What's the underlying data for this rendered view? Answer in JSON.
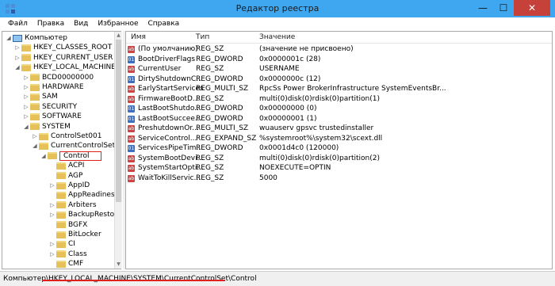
{
  "window": {
    "title": "Редактор реестра",
    "minimize": "—",
    "maximize": "☐",
    "close": "✕"
  },
  "menu": [
    "Файл",
    "Правка",
    "Вид",
    "Избранное",
    "Справка"
  ],
  "tree": [
    {
      "label": "Компьютер",
      "indent": 0,
      "arrow": "◢",
      "icon": "computer"
    },
    {
      "label": "HKEY_CLASSES_ROOT",
      "indent": 1,
      "arrow": "▷",
      "icon": "folder"
    },
    {
      "label": "HKEY_CURRENT_USER",
      "indent": 1,
      "arrow": "▷",
      "icon": "folder"
    },
    {
      "label": "HKEY_LOCAL_MACHINE",
      "indent": 1,
      "arrow": "◢",
      "icon": "folder"
    },
    {
      "label": "BCD00000000",
      "indent": 2,
      "arrow": "▷",
      "icon": "folder"
    },
    {
      "label": "HARDWARE",
      "indent": 2,
      "arrow": "▷",
      "icon": "folder"
    },
    {
      "label": "SAM",
      "indent": 2,
      "arrow": "▷",
      "icon": "folder"
    },
    {
      "label": "SECURITY",
      "indent": 2,
      "arrow": "▷",
      "icon": "folder"
    },
    {
      "label": "SOFTWARE",
      "indent": 2,
      "arrow": "▷",
      "icon": "folder"
    },
    {
      "label": "SYSTEM",
      "indent": 2,
      "arrow": "◢",
      "icon": "folder"
    },
    {
      "label": "ControlSet001",
      "indent": 3,
      "arrow": "▷",
      "icon": "folder"
    },
    {
      "label": "CurrentControlSet",
      "indent": 3,
      "arrow": "◢",
      "icon": "folder"
    },
    {
      "label": "Control",
      "indent": 4,
      "arrow": "◢",
      "icon": "folder",
      "selected": true
    },
    {
      "label": "ACPI",
      "indent": 5,
      "arrow": "",
      "icon": "folder"
    },
    {
      "label": "AGP",
      "indent": 5,
      "arrow": "",
      "icon": "folder"
    },
    {
      "label": "AppID",
      "indent": 5,
      "arrow": "▷",
      "icon": "folder"
    },
    {
      "label": "AppReadiness",
      "indent": 5,
      "arrow": "",
      "icon": "folder"
    },
    {
      "label": "Arbiters",
      "indent": 5,
      "arrow": "▷",
      "icon": "folder"
    },
    {
      "label": "BackupRestore",
      "indent": 5,
      "arrow": "▷",
      "icon": "folder"
    },
    {
      "label": "BGFX",
      "indent": 5,
      "arrow": "",
      "icon": "folder"
    },
    {
      "label": "BitLocker",
      "indent": 5,
      "arrow": "",
      "icon": "folder"
    },
    {
      "label": "CI",
      "indent": 5,
      "arrow": "▷",
      "icon": "folder"
    },
    {
      "label": "Class",
      "indent": 5,
      "arrow": "▷",
      "icon": "folder"
    },
    {
      "label": "CMF",
      "indent": 5,
      "arrow": "",
      "icon": "folder"
    }
  ],
  "columns": [
    "Имя",
    "Тип",
    "Значение"
  ],
  "values": [
    {
      "name": "(По умолчанию)",
      "type": "REG_SZ",
      "data": "(значение не присвоено)",
      "icon": "ab"
    },
    {
      "name": "BootDriverFlags",
      "type": "REG_DWORD",
      "data": "0x0000001c (28)",
      "icon": "bin"
    },
    {
      "name": "CurrentUser",
      "type": "REG_SZ",
      "data": "USERNAME",
      "icon": "ab"
    },
    {
      "name": "DirtyShutdownC...",
      "type": "REG_DWORD",
      "data": "0x0000000c (12)",
      "icon": "bin"
    },
    {
      "name": "EarlyStartServices",
      "type": "REG_MULTI_SZ",
      "data": "RpcSs Power BrokerInfrastructure SystemEventsBr...",
      "icon": "ab"
    },
    {
      "name": "FirmwareBootD...",
      "type": "REG_SZ",
      "data": "multi(0)disk(0)rdisk(0)partition(1)",
      "icon": "ab"
    },
    {
      "name": "LastBootShutdo...",
      "type": "REG_DWORD",
      "data": "0x00000000 (0)",
      "icon": "bin"
    },
    {
      "name": "LastBootSuccee...",
      "type": "REG_DWORD",
      "data": "0x00000001 (1)",
      "icon": "bin"
    },
    {
      "name": "PreshutdownOr...",
      "type": "REG_MULTI_SZ",
      "data": "wuauserv gpsvc trustedinstaller",
      "icon": "ab"
    },
    {
      "name": "ServiceControl...",
      "type": "REG_EXPAND_SZ",
      "data": "%systemroot%\\system32\\scext.dll",
      "icon": "ab"
    },
    {
      "name": "ServicesPipeTim...",
      "type": "REG_DWORD",
      "data": "0x0001d4c0 (120000)",
      "icon": "bin"
    },
    {
      "name": "SystemBootDevi...",
      "type": "REG_SZ",
      "data": "multi(0)disk(0)rdisk(0)partition(2)",
      "icon": "ab"
    },
    {
      "name": "SystemStartOpti...",
      "type": "REG_SZ",
      "data": " NOEXECUTE=OPTIN",
      "icon": "ab"
    },
    {
      "name": "WaitToKillServic...",
      "type": "REG_SZ",
      "data": "5000",
      "icon": "ab"
    }
  ],
  "status": "Компьютер\\HKEY_LOCAL_MACHINE\\SYSTEM\\CurrentControlSet\\Control",
  "colors": {
    "titlebar": "#3ea7f0",
    "selection_outline": "#e0201d",
    "close": "#c7413b"
  }
}
